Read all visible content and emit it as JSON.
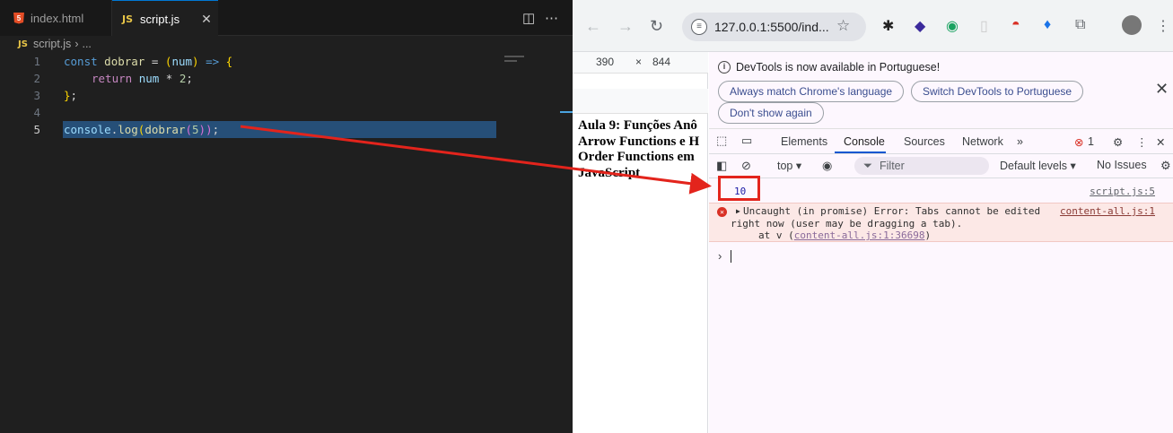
{
  "vscode": {
    "tabs": [
      {
        "label": "index.html",
        "icon": "html5-icon"
      },
      {
        "label": "script.js",
        "icon": "js-icon",
        "close": "✕"
      }
    ],
    "js_badge": "JS",
    "html_badge": "5",
    "toolbar": {
      "split": "◫",
      "more": "⋯"
    },
    "breadcrumb": {
      "file": "script.js",
      "sep": "›",
      "rest": "..."
    },
    "lines": [
      {
        "num": "1"
      },
      {
        "num": "2"
      },
      {
        "num": "3"
      },
      {
        "num": "4"
      },
      {
        "num": "5"
      }
    ],
    "code": {
      "l1_const": "const",
      "l1_name": "dobrar",
      "l1_eq": " = ",
      "l1_open": "(",
      "l1_param": "num",
      "l1_close": ")",
      "l1_arrow": " => ",
      "l1_brace": "{",
      "l2_return": "return",
      "l2_num": "num",
      "l2_op": " * ",
      "l2_two": "2",
      "l2_semi": ";",
      "l3_brace": "}",
      "l3_semi": ";",
      "l5_console": "console",
      "l5_dot": ".",
      "l5_log": "log",
      "l5_p1": "(",
      "l5_dobrar": "dobrar",
      "l5_p2": "(",
      "l5_five": "5",
      "l5_p3": "))",
      "l5_semi": ";"
    }
  },
  "chrome": {
    "nav": {
      "back": "←",
      "forward": "→",
      "reload": "↻"
    },
    "url": "127.0.0.1:5500/ind...",
    "star": "☆",
    "ext_icons": [
      "spider-icon",
      "cube-icon",
      "eye-icon",
      "blank-icon",
      "pokeball-icon",
      "drop-icon",
      "puzzle-icon",
      "avatar-icon",
      "menu-icon"
    ],
    "dims": {
      "w": "390",
      "x": "×",
      "h": "844"
    },
    "page_heading": "Aula 9: Funções Anô Arrow Functions e H Order Functions em JavaScript",
    "page_heading_lines": [
      "Aula 9: Funções Anô",
      "Arrow Functions e H",
      "Order Functions em",
      "JavaScript"
    ]
  },
  "devtools": {
    "info_text": "DevTools is now available in Portuguese!",
    "pill_match": "Always match Chrome's language",
    "pill_switch": "Switch DevTools to Portuguese",
    "pill_dont": "Don't show again",
    "close": "✕",
    "tabs": [
      "Elements",
      "Console",
      "Sources",
      "Network"
    ],
    "more_tabs": "»",
    "error_count": "1",
    "context": "top ▾",
    "filter": "Filter",
    "levels": "Default levels ▾",
    "issues": "No Issues",
    "log_value": "10",
    "log_source": "script.js:5",
    "error_line1": "Uncaught (in promise) Error: Tabs cannot be edited",
    "error_line2": "right now (user may be dragging a tab).",
    "error_at_prefix": "at v (",
    "error_at_link": "content-all.js:1:36698",
    "error_at_suffix": ")",
    "error_source": "content-all.js:1",
    "prompt": "›"
  },
  "colors": {
    "annotation_red": "#e3241c",
    "vscode_bg": "#1f1f1f",
    "selection": "#264f78"
  }
}
